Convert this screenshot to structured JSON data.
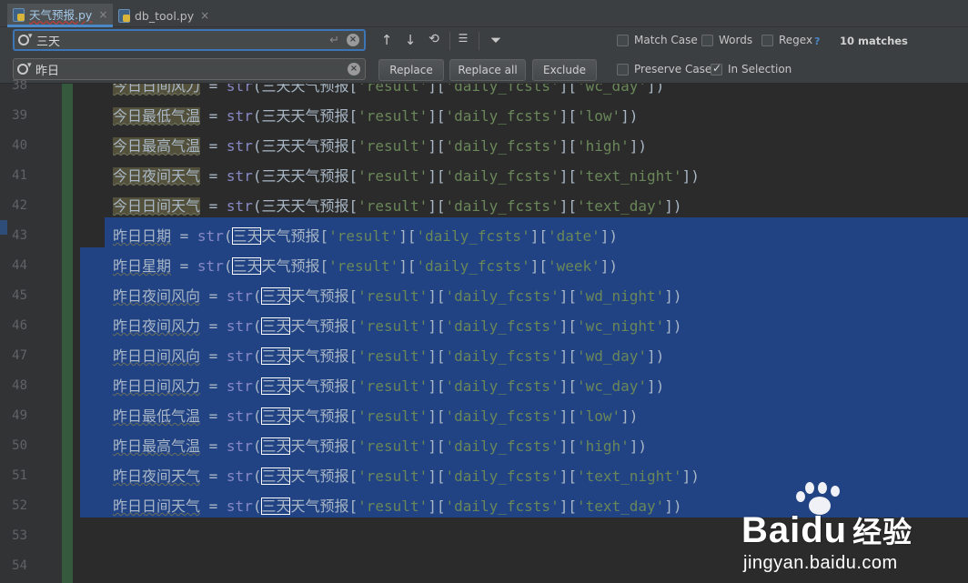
{
  "tabs": [
    {
      "name": "天气预报.py",
      "close": "×",
      "active": true
    },
    {
      "name": "db_tool.py",
      "close": "×",
      "active": false
    }
  ],
  "find": {
    "search_value": "三天",
    "replace_value": "昨日",
    "replace_label": "Replace",
    "replace_all_label": "Replace all",
    "exclude_label": "Exclude",
    "match_case": {
      "label": "Match Case",
      "checked": false
    },
    "words": {
      "label": "Words",
      "checked": false
    },
    "regex": {
      "label": "Regex",
      "checked": false
    },
    "help": "?",
    "matches": "10 matches",
    "preserve_case": {
      "label": "Preserve Case",
      "checked": false
    },
    "in_selection": {
      "label": "In Selection",
      "checked": true
    }
  },
  "editor": {
    "lines": [
      {
        "num": "38",
        "var": "今日日间风力",
        "target": "三天天气预报",
        "key": "wc_day",
        "selected": false
      },
      {
        "num": "39",
        "var": "今日最低气温",
        "target": "三天天气预报",
        "key": "low",
        "selected": false
      },
      {
        "num": "40",
        "var": "今日最高气温",
        "target": "三天天气预报",
        "key": "high",
        "selected": false
      },
      {
        "num": "41",
        "var": "今日夜间天气",
        "target": "三天天气预报",
        "key": "text_night",
        "selected": false
      },
      {
        "num": "42",
        "var": "今日日间天气",
        "target": "三天天气预报",
        "key": "text_day",
        "selected": false
      },
      {
        "num": "43",
        "var": "昨日日期",
        "target": "三天天气预报",
        "key": "date",
        "selected": true
      },
      {
        "num": "44",
        "var": "昨日星期",
        "target": "三天天气预报",
        "key": "week",
        "selected": true
      },
      {
        "num": "45",
        "var": "昨日夜间风向",
        "target": "三天天气预报",
        "key": "wd_night",
        "selected": true
      },
      {
        "num": "46",
        "var": "昨日夜间风力",
        "target": "三天天气预报",
        "key": "wc_night",
        "selected": true
      },
      {
        "num": "47",
        "var": "昨日日间风向",
        "target": "三天天气预报",
        "key": "wd_day",
        "selected": true
      },
      {
        "num": "48",
        "var": "昨日日间风力",
        "target": "三天天气预报",
        "key": "wc_day",
        "selected": true
      },
      {
        "num": "49",
        "var": "昨日最低气温",
        "target": "三天天气预报",
        "key": "low",
        "selected": true
      },
      {
        "num": "50",
        "var": "昨日最高气温",
        "target": "三天天气预报",
        "key": "high",
        "selected": true
      },
      {
        "num": "51",
        "var": "昨日夜间天气",
        "target": "三天天气预报",
        "key": "text_night",
        "selected": true
      },
      {
        "num": "52",
        "var": "昨日日间天气",
        "target": "三天天气预报",
        "key": "text_day",
        "selected": true
      },
      {
        "num": "53"
      },
      {
        "num": "54"
      }
    ],
    "assign": " = ",
    "fn": "str",
    "key1": "result",
    "key2": "daily_fcsts"
  },
  "watermark": {
    "brand_latin": "Bai",
    "brand_du": "du",
    "brand_cn": "经验",
    "url": "jingyan.baidu.com"
  }
}
